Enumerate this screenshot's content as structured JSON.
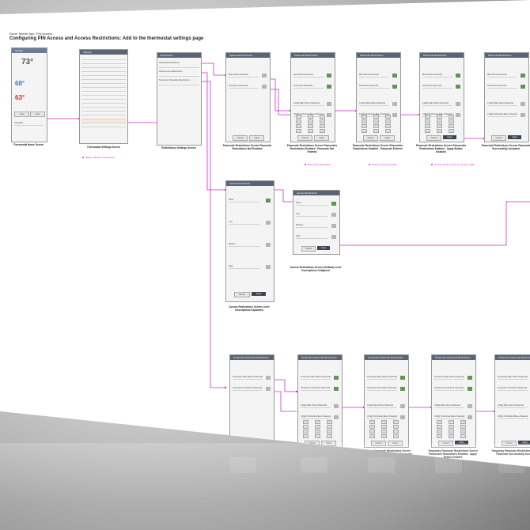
{
  "header": {
    "app": "Rover Mobile App: PIN Access",
    "title": "Configuring PIN Access and Access Restrictions: Add to the thermostat settings page"
  },
  "home": {
    "title": "Garage",
    "current_temp": "73°",
    "cool_temp": "68°",
    "heat_temp": "63°",
    "mode": "Auto",
    "fan": "Auto",
    "status": "Occupied",
    "caption": "Thermostat Home Screen"
  },
  "settings": {
    "title": "Settings",
    "caption": "Thermostat Settings Screen",
    "note": "Beige indicates new item(s)"
  },
  "restrictions": {
    "title": "Restrictions",
    "items": [
      "Passcode Restrictions",
      "Access Level Restrictions",
      "Temporary Passcode Restrictions"
    ],
    "caption": "Restrictions Settings Screen"
  },
  "pr_flow": {
    "title": "Passcode Restrictions",
    "rows": [
      "Main Menu Passcode",
      "Technician Passcode",
      "4 Digit Main Menu Passcode",
      "4 Digit Technician Menu Passcode"
    ],
    "captions": [
      "Passcode Restrictions Screen Passcode Restrictions Not Enabled",
      "Passcode Restrictions Screen Passcodes Restrictions Enabled - Passcode Not Entered",
      "Passcode Restrictions Screen Passcodes Restrictions Enabled - Passcode Entered",
      "Passcode Restrictions Screen Passcodes Restrictions Enabled - Apply Button Enabled",
      "Passcode Restrictions Screen Passcode Successfully Accepted"
    ],
    "notes": [
      "Sync both passcodes",
      "Unsync both passcodes",
      "Cancel sends screen to previous state"
    ],
    "cancel": "Cancel",
    "apply": "Apply"
  },
  "access": {
    "title": "Access Restrictions",
    "levels": [
      "None",
      "Low",
      "Medium",
      "High"
    ],
    "caption_expanded": "Access Restrictions Screen Level Descriptions Expanded",
    "caption_collapsed": "Access Restrictions Screen (Default) Level Descriptions Collapsed",
    "cancel": "Cancel",
    "apply": "Apply"
  },
  "tpr_flow": {
    "title": "Temporary Passcode Restrictions",
    "rows": [
      "Temporary Main Menu Passcode",
      "Temporary Technician Passcode",
      "4 Digit Main Menu Passcode",
      "4 Digit Technician Menu Passcode"
    ],
    "captions": [
      "Temporary Passcode Restrictions Screen Passcode Restrictions Not Enabled",
      "Temporary Passcode Restrictions Screen Passcodes Restrictions Enabled - Passcode Not Entered",
      "Temporary Passcode Restrictions Screen Passcodes Restrictions Enabled - Passcode Entered",
      "Temporary Passcode Restrictions Screen Passcodes Restrictions Enabled - Apply Button Enabled",
      "Temporary Passcode Restrictions Screen Passcode Successfully Accepted"
    ],
    "cancel": "Cancel",
    "apply": "Apply"
  },
  "colors": {
    "connector": "#d22ad2",
    "header_bar": "#5a6573",
    "check_on": "#5a9a4c",
    "check_off": "#b5b5b5"
  }
}
